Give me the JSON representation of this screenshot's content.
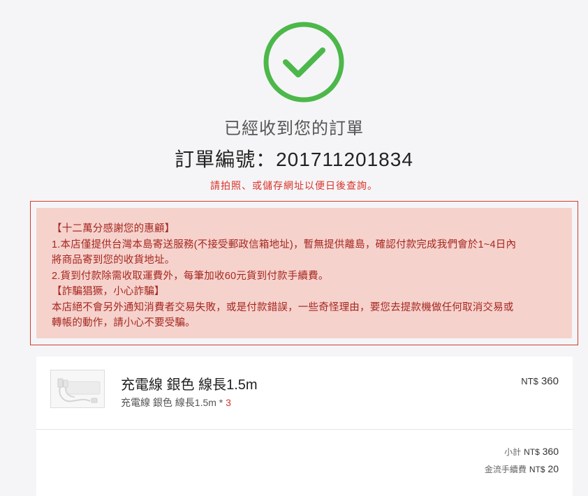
{
  "confirmation": {
    "icon": "check-circle-icon",
    "accent_color": "#4cb84a",
    "received_text": "已經收到您的訂單",
    "order_label": "訂單編號：",
    "order_number": "201711201834",
    "bookmark_hint": "請拍照、或儲存網址以便日後查詢。"
  },
  "notice": {
    "lines": [
      "【十二萬分感謝您的惠顧】",
      "1.本店僅提供台灣本島寄送服務(不接受郵政信箱地址)，暫無提供離島，確認付款完成我們會於1~4日內",
      "將商品寄到您的收貨地址。",
      "2.貨到付款除需收取運費外，每筆加收60元貨到付款手續費。",
      "【詐騙猖獗，小心詐騙】",
      "本店絕不會另外通知消費者交易失敗，或是付款錯誤，一些奇怪理由，要您去提款機做任何取消交易或",
      "轉帳的動作，請小心不要受騙。"
    ],
    "text_color": "#a5281f",
    "background_color": "#f6d2cd",
    "border_color": "#d43a2f"
  },
  "order": {
    "item": {
      "title": "充電線 銀色 線長1.5m",
      "variant": "充電線 銀色 線長1.5m",
      "qty_sep": " * ",
      "qty": "3",
      "currency": "NT$",
      "price": "360",
      "thumbnail": "cable-product-image"
    },
    "summary": {
      "subtotal_label": "小計",
      "subtotal_currency": "NT$",
      "subtotal_value": "360",
      "fee_label": "金流手續費",
      "fee_currency": "NT$",
      "fee_value": "20"
    }
  }
}
